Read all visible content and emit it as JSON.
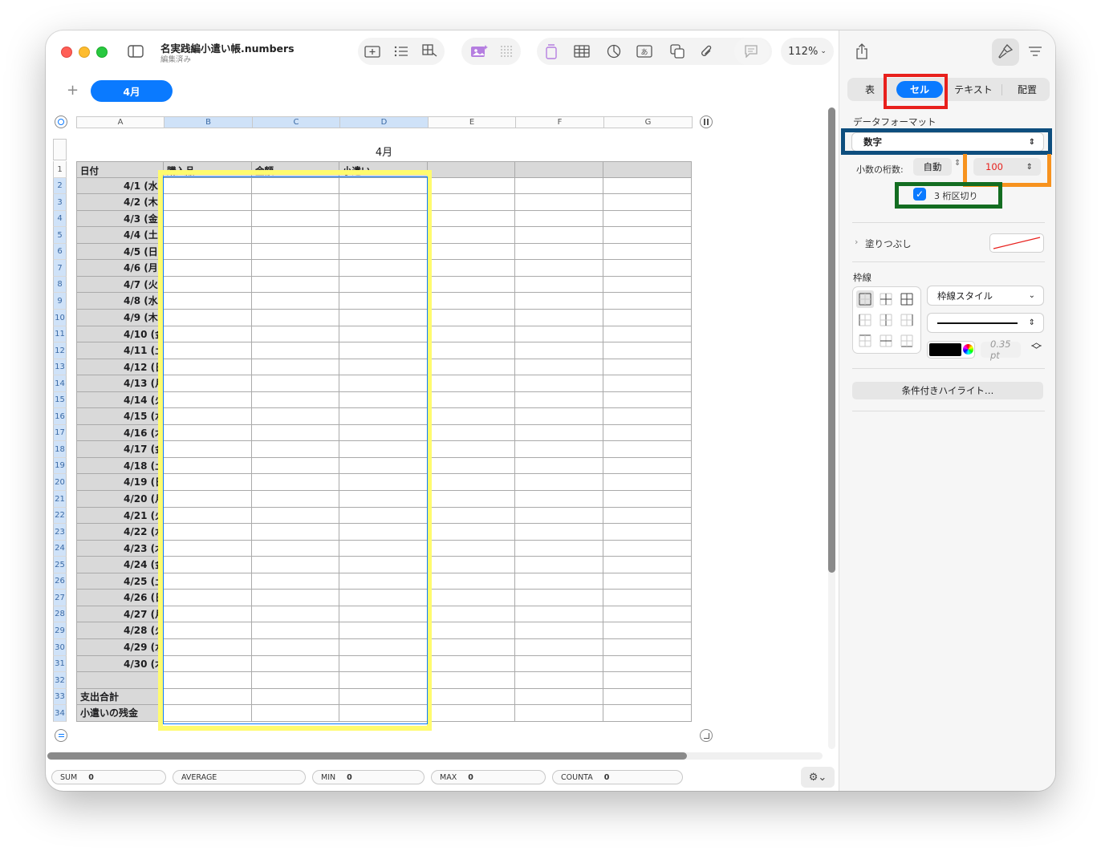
{
  "window": {
    "doc_title": "名実践編小遣い帳.numbers",
    "doc_status": "編集済み",
    "zoom": "112%"
  },
  "sheet": {
    "add_symbol": "+",
    "active_tab": "4月"
  },
  "table": {
    "title": "4月",
    "columns": [
      "A",
      "B",
      "C",
      "D",
      "E",
      "F",
      "G"
    ],
    "header_row": [
      "日付",
      "購入品",
      "金額",
      "小遣い",
      "",
      "",
      ""
    ],
    "dates": [
      "4/1 (水",
      "4/2 (木",
      "4/3 (金",
      "4/4 (土",
      "4/5 (日",
      "4/6 (月",
      "4/7 (火",
      "4/8 (水",
      "4/9 (木",
      "4/10 (金",
      "4/11 (土",
      "4/12 (日",
      "4/13 (月",
      "4/14 (火",
      "4/15 (水",
      "4/16 (木",
      "4/17 (金",
      "4/18 (土",
      "4/19 (日",
      "4/20 (月",
      "4/21 (火",
      "4/22 (水",
      "4/23 (木",
      "4/24 (金",
      "4/25 (土",
      "4/26 (日",
      "4/27 (月",
      "4/28 (火",
      "4/29 (水",
      "4/30 (木"
    ],
    "footer_rows": [
      "",
      "支出合計",
      "小遣いの残金"
    ]
  },
  "statusbar": {
    "sum_label": "SUM",
    "sum_value": "0",
    "avg_label": "AVERAGE",
    "min_label": "MIN",
    "min_value": "0",
    "max_label": "MAX",
    "max_value": "0",
    "counta_label": "COUNTA",
    "counta_value": "0"
  },
  "inspector": {
    "tabs": [
      "表",
      "セル",
      "テキスト",
      "配置"
    ],
    "active_tab": "セル",
    "data_format_label": "データフォーマット",
    "data_format_value": "数字",
    "decimals_label": "小数の桁数:",
    "decimals_value": "自動",
    "sample_value": "100",
    "thousands_label": "3 桁区切り",
    "thousands_checked": true,
    "fill_label": "塗りつぶし",
    "border_label": "枠線",
    "border_style": "枠線スタイル",
    "border_width": "0.35 pt",
    "conditional_button": "条件付きハイライト…"
  },
  "colors": {
    "accent": "#0a7aff",
    "highlight_yellow": "#fffb6e",
    "frame_red": "#e8201c",
    "frame_blue": "#0e4e7e",
    "frame_orange": "#f7921e",
    "frame_green": "#136d21",
    "sample_red": "#e8201c"
  }
}
